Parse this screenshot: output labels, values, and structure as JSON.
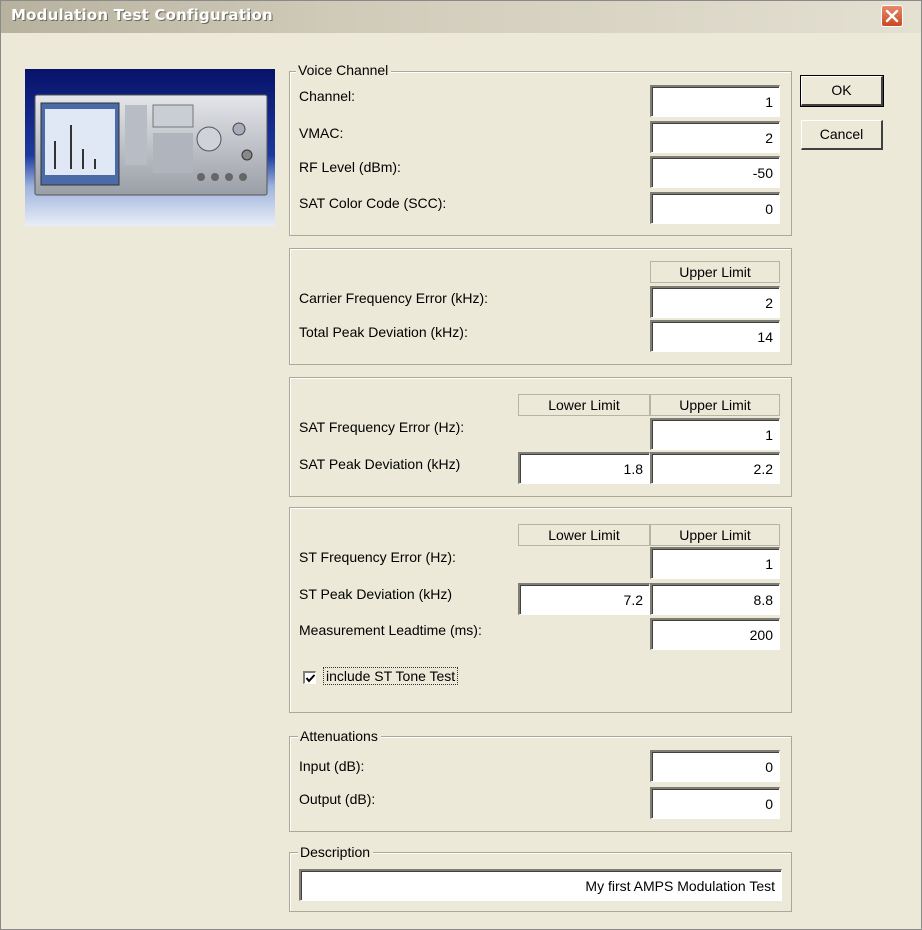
{
  "window": {
    "title": "Modulation Test Configuration"
  },
  "buttons": {
    "ok": "OK",
    "cancel": "Cancel"
  },
  "voice_channel": {
    "legend": "Voice Channel",
    "channel": {
      "label": "Channel:",
      "value": "1"
    },
    "vmac": {
      "label": "VMAC:",
      "value": "2"
    },
    "rf_level": {
      "label": "RF Level (dBm):",
      "value": "-50"
    },
    "scc": {
      "label": "SAT Color Code (SCC):",
      "value": "0"
    }
  },
  "carrier": {
    "upper_header": "Upper Limit",
    "freq_error": {
      "label": "Carrier Frequency Error (kHz):",
      "upper": "2"
    },
    "peak_dev": {
      "label": "Total Peak Deviation (kHz):",
      "upper": "14"
    }
  },
  "sat": {
    "lower_header": "Lower Limit",
    "upper_header": "Upper Limit",
    "freq_error": {
      "label": "SAT Frequency Error (Hz):",
      "upper": "1"
    },
    "peak_dev": {
      "label": "SAT Peak Deviation (kHz)",
      "lower": "1.8",
      "upper": "2.2"
    }
  },
  "st": {
    "lower_header": "Lower Limit",
    "upper_header": "Upper Limit",
    "freq_error": {
      "label": "ST Frequency Error (Hz):",
      "upper": "1"
    },
    "peak_dev": {
      "label": "ST Peak Deviation (kHz)",
      "lower": "7.2",
      "upper": "8.8"
    },
    "leadtime": {
      "label": "Measurement Leadtime (ms):",
      "value": "200"
    },
    "include_tone": {
      "label": "include ST Tone Test",
      "checked": true
    }
  },
  "attenuations": {
    "legend": "Attenuations",
    "input": {
      "label": "Input (dB):",
      "value": "0"
    },
    "output": {
      "label": "Output (dB):",
      "value": "0"
    }
  },
  "description": {
    "legend": "Description",
    "value": "My first AMPS Modulation Test"
  },
  "icons": {
    "close": "close-icon",
    "check": "checkmark-icon",
    "photo": "instrument-photo"
  },
  "colors": {
    "title_bar": "#cfcab8",
    "dialog_bg": "#ece9d8",
    "close_button": "#d8603a"
  }
}
